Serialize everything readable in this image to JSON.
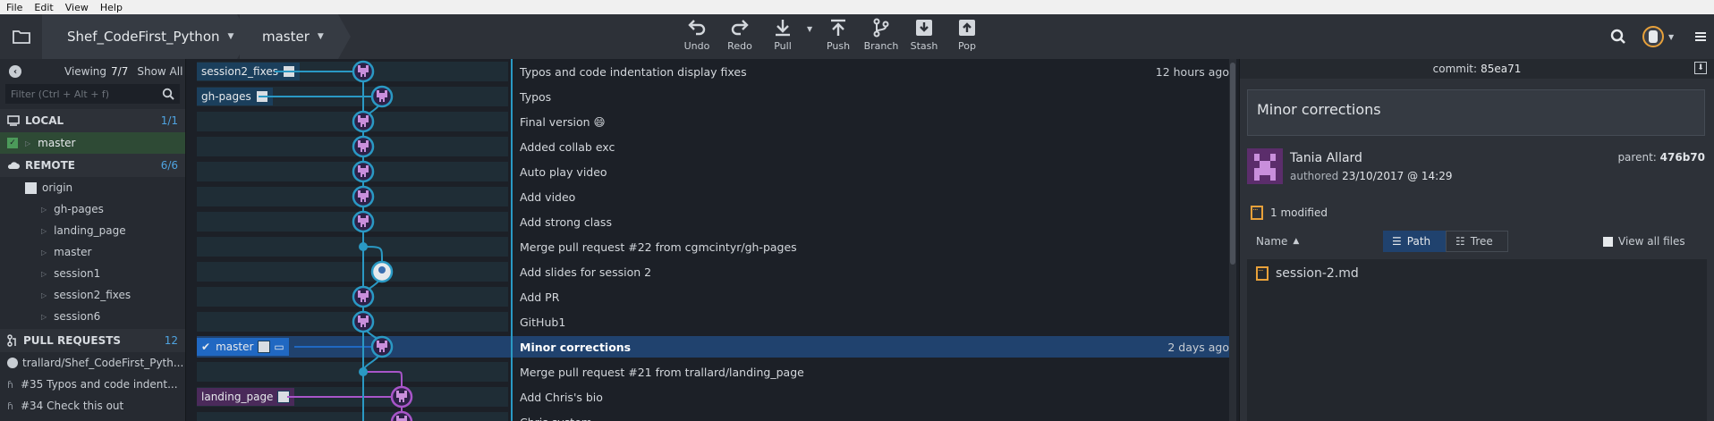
{
  "menu": [
    "File",
    "Edit",
    "View",
    "Help"
  ],
  "toolbar": {
    "repo": "Shef_CodeFirst_Python",
    "branch": "master",
    "undo": "Undo",
    "redo": "Redo",
    "pull": "Pull",
    "push": "Push",
    "branch_btn": "Branch",
    "stash": "Stash",
    "pop": "Pop"
  },
  "sidebar": {
    "viewing_label": "Viewing",
    "viewing_count": "7/7",
    "show_all": "Show All",
    "filter_placeholder": "Filter (Ctrl + Alt + f)",
    "local": {
      "title": "LOCAL",
      "count": "1/1",
      "branches": [
        "master"
      ]
    },
    "remote": {
      "title": "REMOTE",
      "count": "6/6",
      "origin": "origin",
      "branches": [
        "gh-pages",
        "landing_page",
        "master",
        "session1",
        "session2_fixes",
        "session6"
      ]
    },
    "pull_requests": {
      "title": "PULL REQUESTS",
      "count": "12",
      "repo": "trallard/Shef_CodeFirst_Pyth...",
      "items": [
        "#35 Typos and code indent...",
        "#34 Check this out"
      ]
    }
  },
  "commits": [
    {
      "message": "Typos and code indentation display fixes",
      "time": "12 hours ago",
      "ref": "session2_fixes"
    },
    {
      "message": "Typos",
      "time": "",
      "ref": "gh-pages"
    },
    {
      "message": "Final version 😄",
      "time": "",
      "ref": ""
    },
    {
      "message": "Added collab exc",
      "time": "",
      "ref": ""
    },
    {
      "message": "Auto play video",
      "time": "",
      "ref": ""
    },
    {
      "message": "Add video",
      "time": "",
      "ref": ""
    },
    {
      "message": "Add strong class",
      "time": "",
      "ref": ""
    },
    {
      "message": "Merge pull request #22 from cgmcintyr/gh-pages",
      "time": "",
      "ref": ""
    },
    {
      "message": "Add slides for session 2",
      "time": "",
      "ref": ""
    },
    {
      "message": "Add PR",
      "time": "",
      "ref": ""
    },
    {
      "message": "GitHub1",
      "time": "",
      "ref": ""
    },
    {
      "message": "Minor corrections",
      "time": "2 days ago",
      "ref": "master"
    },
    {
      "message": "Merge pull request #21 from trallard/landing_page",
      "time": "",
      "ref": ""
    },
    {
      "message": "Add Chris's bio",
      "time": "",
      "ref": "landing_page"
    },
    {
      "message": "Chris system",
      "time": "",
      "ref": ""
    }
  ],
  "details": {
    "commit_label": "commit:",
    "commit_sha": "85ea71",
    "summary": "Minor corrections",
    "author": "Tania Allard",
    "authored_label": "authored",
    "authored_date": "23/10/2017 @ 14:29",
    "parent_label": "parent:",
    "parent_sha": "476b70",
    "modified": "1 modified",
    "name_col": "Name",
    "path_btn": "Path",
    "tree_btn": "Tree",
    "view_all": "View all files",
    "files": [
      "session-2.md"
    ]
  },
  "colors": {
    "graph_teal": "#2a99c4",
    "graph_purple": "#a855c9",
    "selected_row": "#20426e"
  }
}
